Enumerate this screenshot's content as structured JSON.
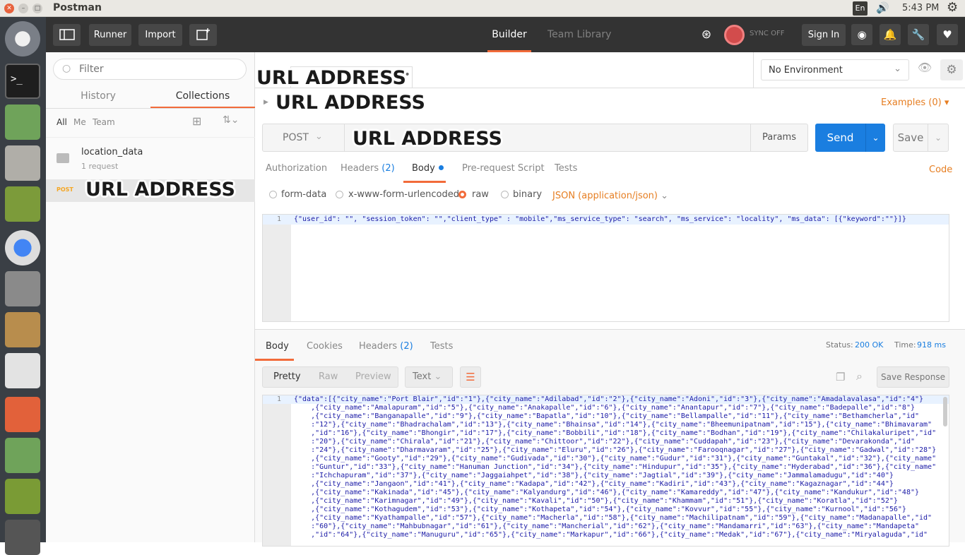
{
  "window": {
    "title": "Postman"
  },
  "tray": {
    "lang": "En",
    "time": "5:43 PM"
  },
  "header": {
    "runner": "Runner",
    "import": "Import",
    "builder": "Builder",
    "team_library": "Team Library",
    "sync": "SYNC OFF",
    "sign_in": "Sign In"
  },
  "sidebar": {
    "filter_placeholder": "Filter",
    "tabs": [
      "History",
      "Collections"
    ],
    "filters": [
      "All",
      "Me",
      "Team"
    ],
    "collection": {
      "name": "location_data",
      "count": "1 request"
    },
    "request": {
      "method": "POST"
    }
  },
  "environment": {
    "selected": "No Environment"
  },
  "request": {
    "examples": "Examples (0)",
    "method": "POST",
    "params": "Params",
    "send": "Send",
    "save": "Save",
    "tabs": {
      "authorization": "Authorization",
      "headers": "Headers",
      "headers_count": "(2)",
      "body": "Body",
      "pre_request": "Pre-request Script",
      "tests": "Tests"
    },
    "code": "Code",
    "body_modes": [
      "form-data",
      "x-www-form-urlencoded",
      "raw",
      "binary"
    ],
    "content_type": "JSON (application/json)",
    "line_no": "1",
    "body_text": "{\"user_id\": \"\", \"session_token\": \"\",\"client_type\" : \"mobile\",\"ms_service_type\": \"search\", \"ms_service\": \"locality\", \"ms_data\": [{\"keyword\":\"\"}]}"
  },
  "response": {
    "tabs": {
      "body": "Body",
      "cookies": "Cookies",
      "headers": "Headers",
      "headers_count": "(2)",
      "tests": "Tests"
    },
    "status_label": "Status:",
    "status": "200 OK",
    "time_label": "Time:",
    "time": "918 ms",
    "formats": [
      "Pretty",
      "Raw",
      "Preview"
    ],
    "type": "Text",
    "save_response": "Save Response",
    "line_no": "1",
    "lines": [
      "{\"data\":[{\"city_name\":\"Port Blair\",\"id\":\"1\"},{\"city_name\":\"Adilabad\",\"id\":\"2\"},{\"city_name\":\"Adoni\",\"id\":\"3\"},{\"city_name\":\"Amadalavalasa\",\"id\":\"4\"}",
      "    ,{\"city_name\":\"Amalapuram\",\"id\":\"5\"},{\"city_name\":\"Anakapalle\",\"id\":\"6\"},{\"city_name\":\"Anantapur\",\"id\":\"7\"},{\"city_name\":\"Badepalle\",\"id\":\"8\"}",
      "    ,{\"city_name\":\"Banganapalle\",\"id\":\"9\"},{\"city_name\":\"Bapatla\",\"id\":\"10\"},{\"city_name\":\"Bellampalle\",\"id\":\"11\"},{\"city_name\":\"Bethamcherla\",\"id\"",
      "    :\"12\"},{\"city_name\":\"Bhadrachalam\",\"id\":\"13\"},{\"city_name\":\"Bhainsa\",\"id\":\"14\"},{\"city_name\":\"Bheemunipatnam\",\"id\":\"15\"},{\"city_name\":\"Bhimavaram\"",
      "    ,\"id\":\"16\"},{\"city_name\":\"Bhongir\",\"id\":\"17\"},{\"city_name\":\"Bobbili\",\"id\":\"18\"},{\"city_name\":\"Bodhan\",\"id\":\"19\"},{\"city_name\":\"Chilakaluripet\",\"id\"",
      "    :\"20\"},{\"city_name\":\"Chirala\",\"id\":\"21\"},{\"city_name\":\"Chittoor\",\"id\":\"22\"},{\"city_name\":\"Cuddapah\",\"id\":\"23\"},{\"city_name\":\"Devarakonda\",\"id\"",
      "    :\"24\"},{\"city_name\":\"Dharmavaram\",\"id\":\"25\"},{\"city_name\":\"Eluru\",\"id\":\"26\"},{\"city_name\":\"Farooqnagar\",\"id\":\"27\"},{\"city_name\":\"Gadwal\",\"id\":\"28\"}",
      "    ,{\"city_name\":\"Gooty\",\"id\":\"29\"},{\"city_name\":\"Gudivada\",\"id\":\"30\"},{\"city_name\":\"Gudur\",\"id\":\"31\"},{\"city_name\":\"Guntakal\",\"id\":\"32\"},{\"city_name\"",
      "    :\"Guntur\",\"id\":\"33\"},{\"city_name\":\"Hanuman Junction\",\"id\":\"34\"},{\"city_name\":\"Hindupur\",\"id\":\"35\"},{\"city_name\":\"Hyderabad\",\"id\":\"36\"},{\"city_name\"",
      "    :\"Ichchapuram\",\"id\":\"37\"},{\"city_name\":\"Jaggaiahpet\",\"id\":\"38\"},{\"city_name\":\"Jagtial\",\"id\":\"39\"},{\"city_name\":\"Jammalamadugu\",\"id\":\"40\"}",
      "    ,{\"city_name\":\"Jangaon\",\"id\":\"41\"},{\"city_name\":\"Kadapa\",\"id\":\"42\"},{\"city_name\":\"Kadiri\",\"id\":\"43\"},{\"city_name\":\"Kagaznagar\",\"id\":\"44\"}",
      "    ,{\"city_name\":\"Kakinada\",\"id\":\"45\"},{\"city_name\":\"Kalyandurg\",\"id\":\"46\"},{\"city_name\":\"Kamareddy\",\"id\":\"47\"},{\"city_name\":\"Kandukur\",\"id\":\"48\"}",
      "    ,{\"city_name\":\"Karimnagar\",\"id\":\"49\"},{\"city_name\":\"Kavali\",\"id\":\"50\"},{\"city_name\":\"Khammam\",\"id\":\"51\"},{\"city_name\":\"Koratla\",\"id\":\"52\"}",
      "    ,{\"city_name\":\"Kothagudem\",\"id\":\"53\"},{\"city_name\":\"Kothapeta\",\"id\":\"54\"},{\"city_name\":\"Kovvur\",\"id\":\"55\"},{\"city_name\":\"Kurnool\",\"id\":\"56\"}",
      "    ,{\"city_name\":\"Kyathampalle\",\"id\":\"57\"},{\"city_name\":\"Macherla\",\"id\":\"58\"},{\"city_name\":\"Machilipatnam\",\"id\":\"59\"},{\"city_name\":\"Madanapalle\",\"id\"",
      "    :\"60\"},{\"city_name\":\"Mahbubnagar\",\"id\":\"61\"},{\"city_name\":\"Mancherial\",\"id\":\"62\"},{\"city_name\":\"Mandamarri\",\"id\":\"63\"},{\"city_name\":\"Mandapeta\"",
      "    ,\"id\":\"64\"},{\"city_name\":\"Manuguru\",\"id\":\"65\"},{\"city_name\":\"Markapur\",\"id\":\"66\"},{\"city_name\":\"Medak\",\"id\":\"67\"},{\"city_name\":\"Miryalaguda\",\"id\""
    ]
  },
  "overlays": [
    "URL ADDRESS",
    "URL ADDRESS",
    "URL ADDRESS",
    "URL ADDRESS"
  ]
}
